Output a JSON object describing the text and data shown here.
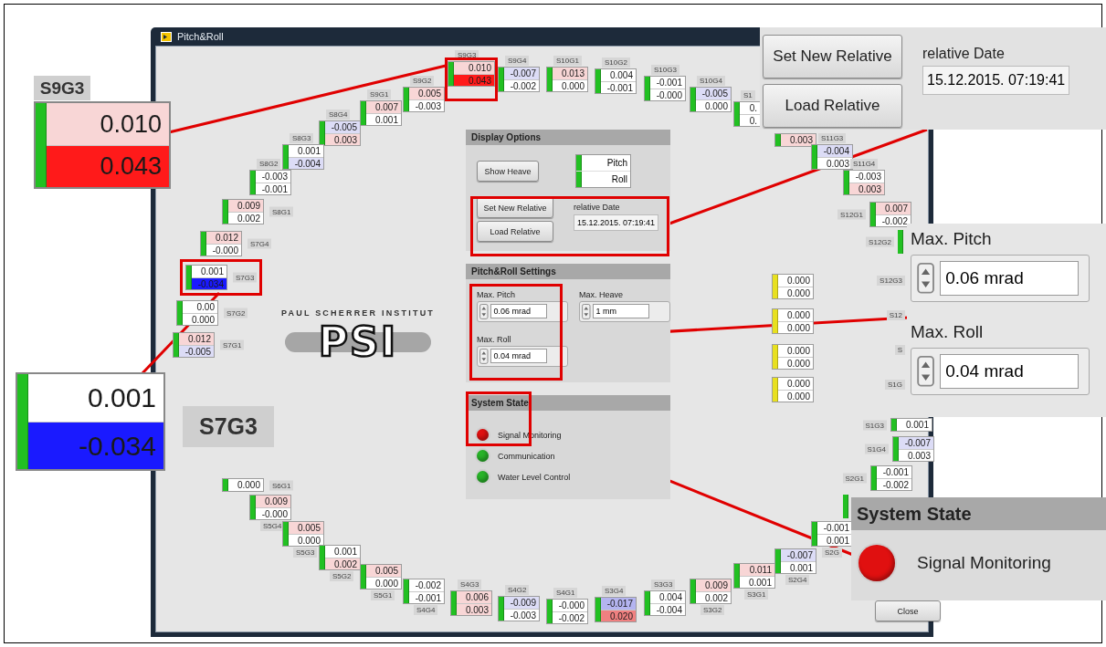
{
  "window": {
    "title": "Pitch&Roll"
  },
  "sensors": [
    {
      "label": "S9G2",
      "color": "#22c022",
      "values": [
        {
          "text": "0.005",
          "color": "#f8d6d6"
        },
        {
          "text": "-0.003",
          "color": "#ffffff"
        }
      ]
    },
    {
      "label": "S9G1",
      "color": "#22c022",
      "values": [
        {
          "text": "0.007",
          "color": "#f8d6d6"
        },
        {
          "text": "0.001",
          "color": "#ffffff"
        }
      ]
    },
    {
      "label": "S8G4",
      "color": "#22c022",
      "values": [
        {
          "text": "-0.005",
          "color": "#dcdcf6"
        },
        {
          "text": "0.003",
          "color": "#f8d6d6"
        }
      ]
    },
    {
      "label": "S8G3",
      "color": "#22c022",
      "values": [
        {
          "text": "0.001",
          "color": "#ffffff"
        },
        {
          "text": "-0.004",
          "color": "#dcdcf6"
        }
      ]
    },
    {
      "label": "S8G2",
      "color": "#22c022",
      "values": [
        {
          "text": "-0.003",
          "color": "#ffffff"
        },
        {
          "text": "-0.001",
          "color": "#ffffff"
        }
      ]
    },
    {
      "label": "S8G1",
      "color": "#22c022",
      "values": [
        {
          "text": "0.009",
          "color": "#f8d6d6"
        },
        {
          "text": "0.002",
          "color": "#ffffff"
        }
      ]
    },
    {
      "label": "S7G4",
      "color": "#22c022",
      "values": [
        {
          "text": "0.012",
          "color": "#f8d6d6"
        },
        {
          "text": "-0.000",
          "color": "#ffffff"
        }
      ]
    },
    {
      "label": "S7G3",
      "color": "#22c022",
      "values": [
        {
          "text": "0.001",
          "color": "#ffffff"
        },
        {
          "text": "-0.034",
          "color": "#1a1aff"
        }
      ]
    },
    {
      "label": "S7G2",
      "color": "#22c022",
      "values": [
        {
          "text": "0.00",
          "color": "#ffffff"
        },
        {
          "text": "0.000",
          "color": "#ffffff"
        }
      ]
    },
    {
      "label": "S7G1",
      "color": "#22c022",
      "values": [
        {
          "text": "0.012",
          "color": "#f8d6d6"
        },
        {
          "text": "-0.005",
          "color": "#dcdcf6"
        }
      ]
    },
    {
      "label": "S9G3",
      "color": "#22c022",
      "values": [
        {
          "text": "0.010",
          "color": "#f8d6d6"
        },
        {
          "text": "0.043",
          "color": "#ff1a1a"
        }
      ]
    },
    {
      "label": "S9G4",
      "color": "#22c022",
      "values": [
        {
          "text": "-0.007",
          "color": "#dcdcf6"
        },
        {
          "text": "-0.002",
          "color": "#ffffff"
        }
      ]
    },
    {
      "label": "S10G1",
      "color": "#22c022",
      "values": [
        {
          "text": "0.013",
          "color": "#f8d6d6"
        },
        {
          "text": "0.000",
          "color": "#ffffff"
        }
      ]
    },
    {
      "label": "S10G2",
      "color": "#22c022",
      "values": [
        {
          "text": "0.004",
          "color": "#ffffff"
        },
        {
          "text": "-0.001",
          "color": "#ffffff"
        }
      ]
    },
    {
      "label": "S10G3",
      "color": "#22c022",
      "values": [
        {
          "text": "-0.001",
          "color": "#ffffff"
        },
        {
          "text": "-0.000",
          "color": "#ffffff"
        }
      ]
    },
    {
      "label": "S10G4",
      "color": "#22c022",
      "values": [
        {
          "text": "-0.005",
          "color": "#dcdcf6"
        },
        {
          "text": "0.000",
          "color": "#ffffff"
        }
      ]
    },
    {
      "label": "S1",
      "color": "#22c022",
      "values": [
        {
          "text": "0.",
          "color": "#ffffff"
        },
        {
          "text": "0.",
          "color": "#ffffff"
        }
      ]
    },
    {
      "color": "#22c022",
      "values": [
        {
          "text": "0.003",
          "color": "#f8d6d6"
        }
      ]
    },
    {
      "label": "S11G3",
      "color": "#22c022",
      "values": [
        {
          "text": "-0.004",
          "color": "#dcdcf6"
        },
        {
          "text": "0.003",
          "color": "#ffffff"
        }
      ]
    },
    {
      "label": "S11G4",
      "color": "#22c022",
      "values": [
        {
          "text": "-0.003",
          "color": "#ffffff"
        },
        {
          "text": "0.003",
          "color": "#f8d6d6"
        }
      ]
    },
    {
      "label": "S12G1",
      "color": "#22c022",
      "values": [
        {
          "text": "0.007",
          "color": "#f8d6d6"
        },
        {
          "text": "-0.002",
          "color": "#ffffff"
        }
      ]
    },
    {
      "label": "S12G2",
      "color": "#22c022"
    },
    {
      "color": "#e8e020",
      "values": [
        {
          "text": "0.000",
          "color": "#ffffff"
        },
        {
          "text": "0.000",
          "color": "#ffffff"
        }
      ]
    },
    {
      "label": "S12G3"
    },
    {
      "color": "#e8e020",
      "values": [
        {
          "text": "0.000",
          "color": "#ffffff"
        },
        {
          "text": "0.000",
          "color": "#ffffff"
        }
      ]
    },
    {
      "label": "S12"
    },
    {
      "color": "#e8e020",
      "values": [
        {
          "text": "0.000",
          "color": "#ffffff"
        },
        {
          "text": "0.000",
          "color": "#ffffff"
        }
      ]
    },
    {
      "label": "S"
    },
    {
      "color": "#e8e020",
      "values": [
        {
          "text": "0.000",
          "color": "#ffffff"
        },
        {
          "text": "0.000",
          "color": "#ffffff"
        }
      ]
    },
    {
      "label": "S1G"
    },
    {
      "label": "S1G3",
      "color": "#22c022",
      "values": [
        {
          "text": "0.001",
          "color": "#ffffff"
        }
      ]
    },
    {
      "label": "S1G4",
      "color": "#22c022",
      "values": [
        {
          "text": "-0.007",
          "color": "#dcdcf6"
        },
        {
          "text": "0.003",
          "color": "#ffffff"
        }
      ]
    },
    {
      "label": "S6G1",
      "color": "#22c022",
      "values": [
        {
          "text": "0.000",
          "color": "#ffffff"
        }
      ]
    },
    {
      "label": "S5G4",
      "color": "#22c022",
      "values": [
        {
          "text": "0.009",
          "color": "#f8d6d6"
        },
        {
          "text": "-0.000",
          "color": "#ffffff"
        }
      ]
    },
    {
      "label": "S5G3",
      "color": "#22c022",
      "values": [
        {
          "text": "0.005",
          "color": "#f8d6d6"
        },
        {
          "text": "0.000",
          "color": "#ffffff"
        }
      ]
    },
    {
      "label": "S5G2",
      "color": "#22c022",
      "values": [
        {
          "text": "0.001",
          "color": "#ffffff"
        },
        {
          "text": "0.002",
          "color": "#f8d6d6"
        }
      ]
    },
    {
      "label": "S5G1",
      "color": "#22c022",
      "values": [
        {
          "text": "0.005",
          "color": "#f8d6d6"
        },
        {
          "text": "0.000",
          "color": "#ffffff"
        }
      ]
    },
    {
      "label": "S4G4",
      "color": "#22c022",
      "values": [
        {
          "text": "-0.002",
          "color": "#ffffff"
        },
        {
          "text": "-0.001",
          "color": "#ffffff"
        }
      ]
    },
    {
      "label": "S4G3",
      "color": "#22c022",
      "values": [
        {
          "text": "0.006",
          "color": "#f8d6d6"
        },
        {
          "text": "0.003",
          "color": "#f8d6d6"
        }
      ]
    },
    {
      "label": "S4G2",
      "color": "#22c022",
      "values": [
        {
          "text": "-0.009",
          "color": "#dcdcf6"
        },
        {
          "text": "-0.003",
          "color": "#ffffff"
        }
      ]
    },
    {
      "label": "S4G1",
      "color": "#22c022",
      "values": [
        {
          "text": "-0.000",
          "color": "#ffffff"
        },
        {
          "text": "-0.002",
          "color": "#ffffff"
        }
      ]
    },
    {
      "label": "S3G4",
      "color": "#22c022",
      "values": [
        {
          "text": "-0.017",
          "color": "#b4b4f0"
        },
        {
          "text": "0.020",
          "color": "#f08080"
        }
      ]
    },
    {
      "label": "S3G3",
      "color": "#22c022",
      "values": [
        {
          "text": "0.004",
          "color": "#ffffff"
        },
        {
          "text": "-0.004",
          "color": "#ffffff"
        }
      ]
    },
    {
      "label": "S3G2",
      "color": "#22c022",
      "values": [
        {
          "text": "0.009",
          "color": "#f8d6d6"
        },
        {
          "text": "0.002",
          "color": "#ffffff"
        }
      ]
    },
    {
      "label": "S3G1",
      "color": "#22c022",
      "values": [
        {
          "text": "0.011",
          "color": "#f8d6d6"
        },
        {
          "text": "0.001",
          "color": "#ffffff"
        }
      ]
    },
    {
      "label": "S2G4",
      "color": "#22c022",
      "values": [
        {
          "text": "-0.007",
          "color": "#dcdcf6"
        },
        {
          "text": "0.001",
          "color": "#ffffff"
        }
      ]
    },
    {
      "label": "S2G",
      "color": "#22c022",
      "values": [
        {
          "text": "-0.001",
          "color": "#ffffff"
        },
        {
          "text": "0.001",
          "color": "#ffffff"
        }
      ]
    },
    {
      "color": "#22c022"
    },
    {
      "label": "S2G1",
      "color": "#22c022",
      "values": [
        {
          "text": "-0.001",
          "color": "#ffffff"
        },
        {
          "text": "-0.002",
          "color": "#ffffff"
        }
      ]
    }
  ],
  "logo": {
    "institute": "PAUL SCHERRER INSTITUT",
    "mark": "PSI"
  },
  "display_options": {
    "title": "Display Options",
    "show_heave_button": "Show Heave",
    "channels": [
      {
        "name": "Pitch"
      },
      {
        "name": "Roll"
      }
    ],
    "set_relative_button": "Set New Relative",
    "load_relative_button": "Load Relative",
    "relative_date_label": "relative Date",
    "relative_date": "15.12.2015. 07:19:41"
  },
  "settings": {
    "title": "Pitch&Roll Settings",
    "fields": [
      {
        "label": "Max. Pitch",
        "value": "0.06 mrad"
      },
      {
        "label": "Max. Heave",
        "value": "1 mm"
      },
      {
        "label": "Max. Roll",
        "value": "0.04 mrad"
      }
    ]
  },
  "system_state": {
    "title": "System State",
    "items": [
      {
        "label": "Signal Monitoring",
        "color": "#e01010"
      },
      {
        "label": "Communication",
        "color": "#28b428"
      },
      {
        "label": "Water Level Control",
        "color": "#28b428"
      }
    ]
  },
  "close_button": "Close",
  "callouts": [
    {
      "kind": "sensor",
      "label": "S9G3",
      "values": [
        {
          "text": "0.010",
          "color": "#f8d6d6"
        },
        {
          "text": "0.043",
          "color": "#ff1a1a"
        }
      ]
    },
    {
      "kind": "relative",
      "set_button": "Set New Relative",
      "load_button": "Load Relative",
      "date_label": "relative Date",
      "date": "15.12.2015. 07:19:41"
    },
    {
      "kind": "sensor",
      "label": "S7G3",
      "values": [
        {
          "text": "0.001",
          "color": "#ffffff"
        },
        {
          "text": "-0.034",
          "color": "#1a1aff"
        }
      ]
    },
    {
      "kind": "limits",
      "fields": [
        {
          "label": "Max. Pitch",
          "value": "0.06 mrad"
        },
        {
          "label": "Max. Roll",
          "value": "0.04 mrad"
        }
      ]
    },
    {
      "kind": "state",
      "title": "System State",
      "item": {
        "label": "Signal Monitoring",
        "color": "#e01010"
      }
    }
  ]
}
